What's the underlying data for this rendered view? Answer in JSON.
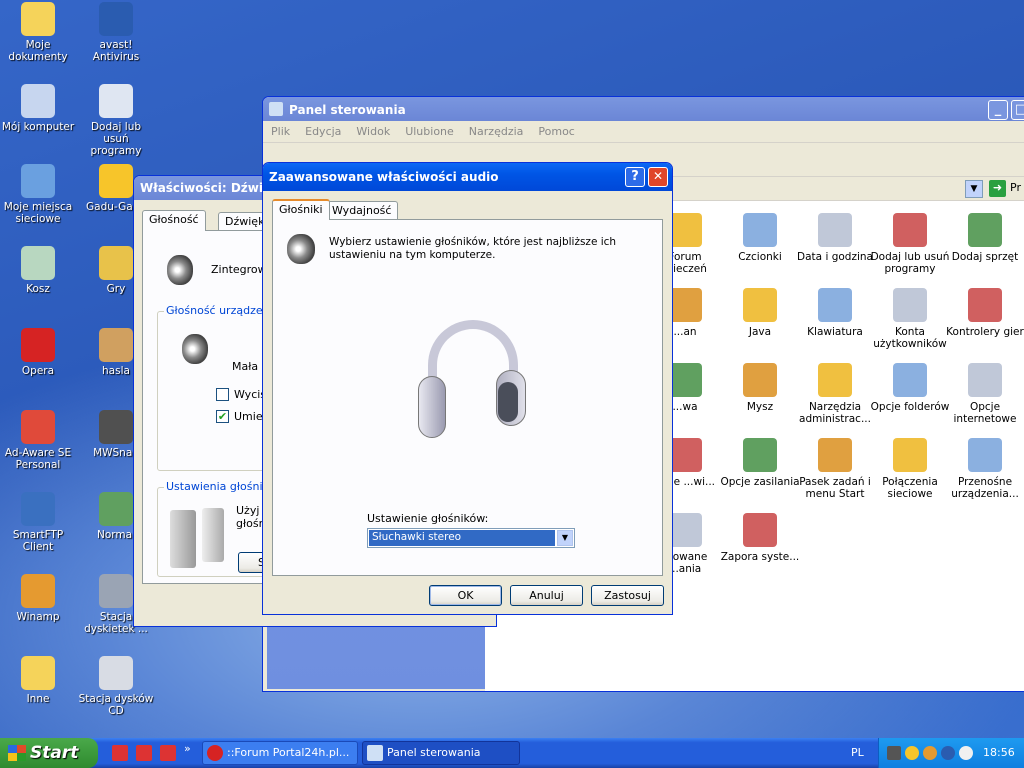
{
  "desktop": {
    "icons": [
      {
        "label": "Moje dokumenty",
        "icon": "folder-icon",
        "color": "#f5d35a"
      },
      {
        "label": "avast! Antivirus",
        "icon": "avast-icon",
        "color": "#2a5cb0"
      },
      {
        "label": "Mój komputer",
        "icon": "computer-icon",
        "color": "#c7d6ef"
      },
      {
        "label": "Dodaj lub usuń programy",
        "icon": "add-remove-icon",
        "color": "#dfe6f2"
      },
      {
        "label": "Moje miejsca sieciowe",
        "icon": "network-icon",
        "color": "#6aa0e0"
      },
      {
        "label": "Gadu-Gadu",
        "icon": "sun-icon",
        "color": "#f7c52a"
      },
      {
        "label": "Kosz",
        "icon": "recycle-bin-icon",
        "color": "#b8d7c0"
      },
      {
        "label": "Gry",
        "icon": "lock-icon",
        "color": "#e8c24a"
      },
      {
        "label": "Opera",
        "icon": "opera-icon",
        "color": "#d62323"
      },
      {
        "label": "hasla",
        "icon": "keys-icon",
        "color": "#d0a060"
      },
      {
        "label": "Ad-Aware SE Personal",
        "icon": "adaware-icon",
        "color": "#e04a3a"
      },
      {
        "label": "MWSnap",
        "icon": "camera-icon",
        "color": "#505050"
      },
      {
        "label": "SmartFTP Client",
        "icon": "smartftp-icon",
        "color": "#3a70c0"
      },
      {
        "label": "Normal",
        "icon": "hat-icon",
        "color": "#60a060"
      },
      {
        "label": "Winamp",
        "icon": "winamp-icon",
        "color": "#e59a30"
      },
      {
        "label": "Stacja dyskietek ...",
        "icon": "floppy-icon",
        "color": "#9aa4b4"
      },
      {
        "label": "Inne",
        "icon": "folder-icon",
        "color": "#f5d35a"
      },
      {
        "label": "Stacja dysków CD",
        "icon": "cd-icon",
        "color": "#d8dce4"
      }
    ]
  },
  "control_panel": {
    "title": "Panel sterowania",
    "menu": [
      "Plik",
      "Edycja",
      "Widok",
      "Ulubione",
      "Narzędzia",
      "Pomoc"
    ],
    "go_label": "Pr",
    "items": [
      {
        "label": "Forum ...ieczeń",
        "icon": "shield-icon"
      },
      {
        "label": "Czcionki",
        "icon": "fonts-folder-icon"
      },
      {
        "label": "Data i godzina",
        "icon": "clock-icon"
      },
      {
        "label": "Dodaj lub usuń programy",
        "icon": "add-remove-icon"
      },
      {
        "label": "Dodaj sprzęt",
        "icon": "hardware-icon"
      },
      {
        "label": "...an",
        "icon": "scanner-icon"
      },
      {
        "label": "Java",
        "icon": "java-icon"
      },
      {
        "label": "Klawiatura",
        "icon": "keyboard-icon"
      },
      {
        "label": "Konta użytkowników",
        "icon": "users-icon"
      },
      {
        "label": "Kontrolery gier",
        "icon": "gamepad-icon"
      },
      {
        "label": "...wa",
        "icon": "misc-icon"
      },
      {
        "label": "Mysz",
        "icon": "mouse-icon"
      },
      {
        "label": "Narzędzia administrac...",
        "icon": "admin-tools-icon"
      },
      {
        "label": "Opcje folderów",
        "icon": "folder-options-icon"
      },
      {
        "label": "Opcje internetowe",
        "icon": "internet-options-icon"
      },
      {
        "label": "...cje ...wi...",
        "icon": "misc-icon"
      },
      {
        "label": "Opcje zasilania",
        "icon": "power-icon"
      },
      {
        "label": "Pasek zadań i menu Start",
        "icon": "taskbar-icon"
      },
      {
        "label": "Połączenia sieciowe",
        "icon": "network-connections-icon"
      },
      {
        "label": "Przenośne urządzenia...",
        "icon": "portable-devices-icon"
      },
      {
        "label": "...owane ...ania",
        "icon": "misc-icon"
      },
      {
        "label": "Zapora syste...",
        "icon": "firewall-icon"
      }
    ]
  },
  "sound_props": {
    "title": "Właściwości: Dźwięki",
    "tabs": [
      "Głośność",
      "Dźwięki"
    ],
    "device_name": "Zintegrowa",
    "volume_group_label": "Głośność urządzenia",
    "volume_low_label": "Mała",
    "mute_label": "Wycisz",
    "place_icon_label": "Umieść",
    "speakers_group_label": "Ustawienia głośników",
    "speakers_desc": "Użyj p głośn",
    "button_label": "Siła",
    "mute_checked": false,
    "place_checked": true
  },
  "audio_dialog": {
    "title": "Zaawansowane właściwości audio",
    "help_label": "?",
    "close_label": "✕",
    "tabs": [
      "Głośniki",
      "Wydajność"
    ],
    "description": "Wybierz ustawienie głośników, które jest najbliższe ich ustawieniu na tym komputerze.",
    "setting_label": "Ustawienie głośników:",
    "setting_value": "Słuchawki stereo",
    "ok_label": "OK",
    "cancel_label": "Anuluj",
    "apply_label": "Zastosuj",
    "accent_color": "#0a246a"
  },
  "taskbar": {
    "start_label": "Start",
    "chevron": "»",
    "tasks": [
      {
        "label": "::Forum Portal24h.pl...",
        "icon": "opera-icon"
      },
      {
        "label": "Panel sterowania",
        "icon": "control-panel-icon"
      }
    ],
    "language": "PL",
    "clock": "18:56"
  }
}
